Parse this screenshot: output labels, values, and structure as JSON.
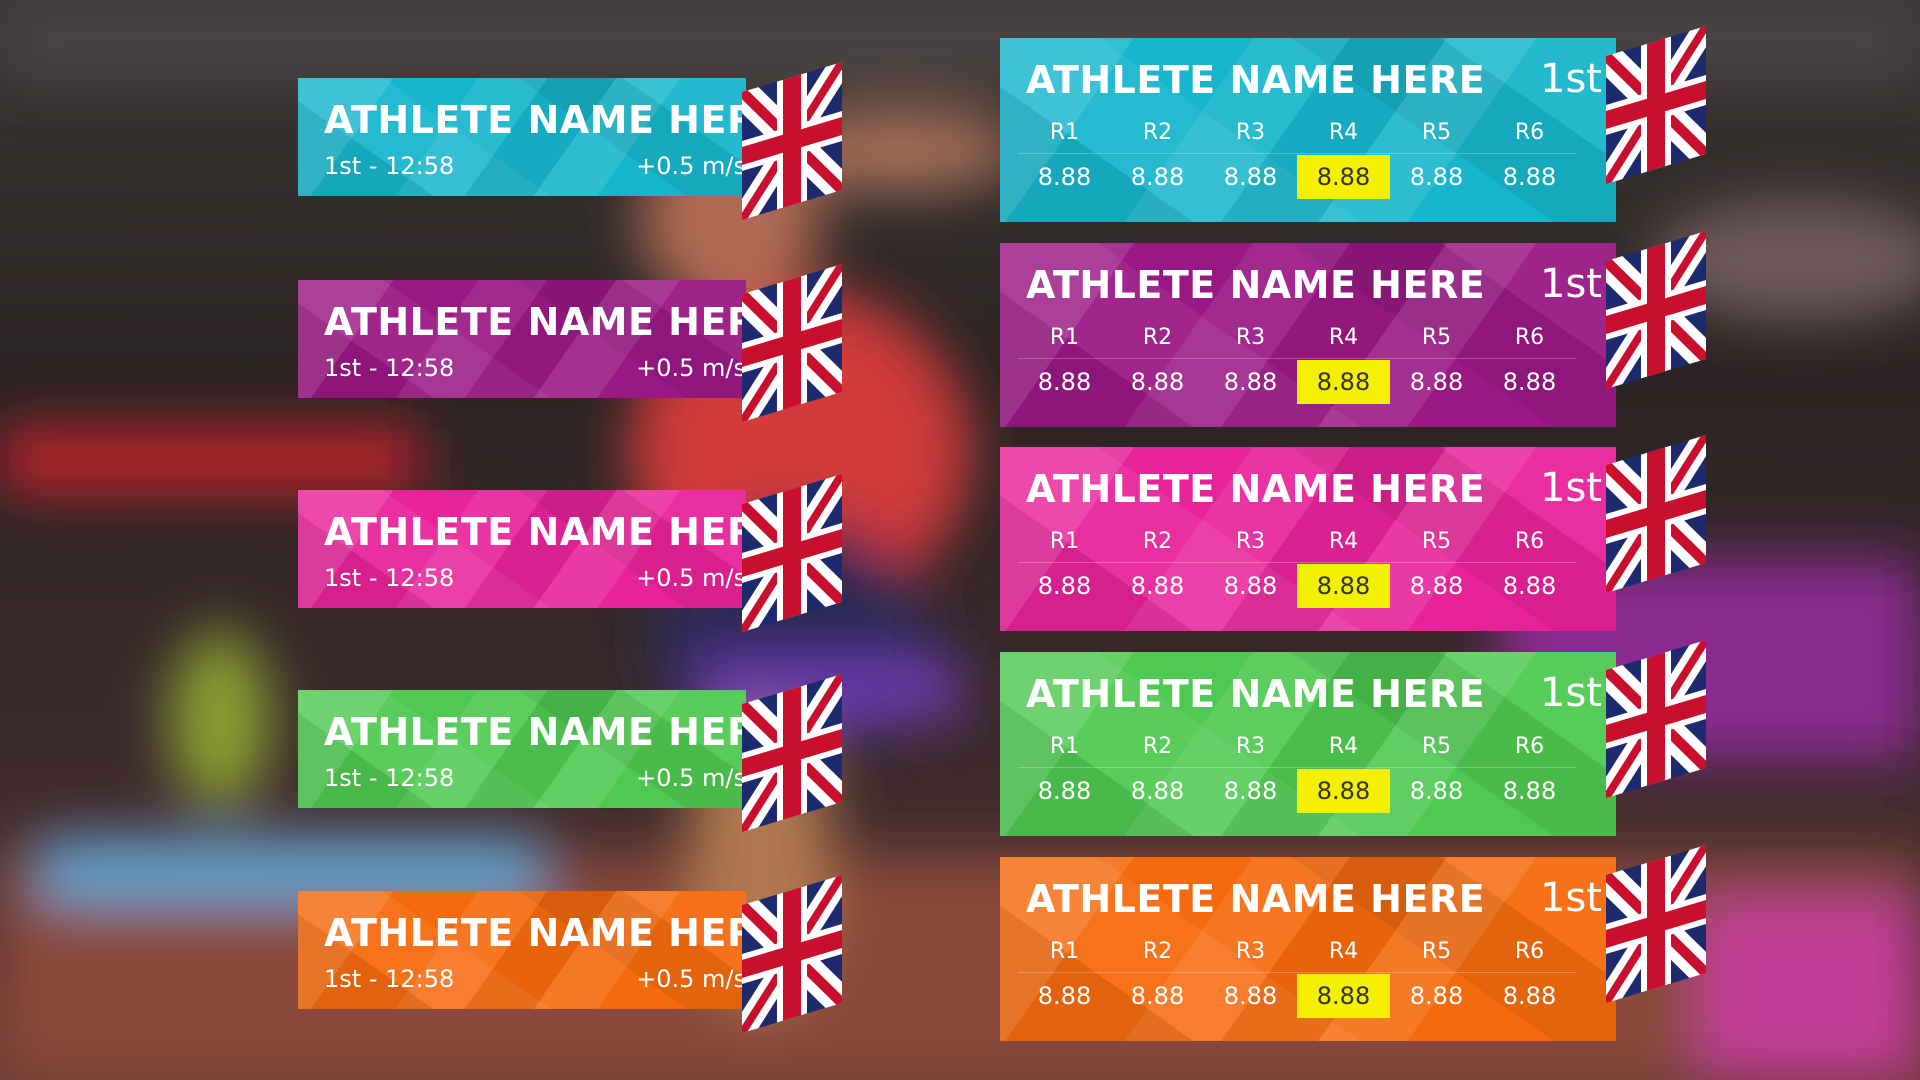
{
  "small_cards": [
    {
      "name": "ATHLETE NAME HERE",
      "position_time": "1st - 12:58",
      "wind": "+0.5 m/s",
      "color": "#17b6cc"
    },
    {
      "name": "ATHLETE NAME HERE",
      "position_time": "1st - 12:58",
      "wind": "+0.5 m/s",
      "color": "#9a1884"
    },
    {
      "name": "ATHLETE NAME HERE",
      "position_time": "1st - 12:58",
      "wind": "+0.5 m/s",
      "color": "#e8239a"
    },
    {
      "name": "ATHLETE NAME HERE",
      "position_time": "1st - 12:58",
      "wind": "+0.5 m/s",
      "color": "#4fc951"
    },
    {
      "name": "ATHLETE NAME HERE",
      "position_time": "1st - 12:58",
      "wind": "+0.5 m/s",
      "color": "#f56a0e"
    }
  ],
  "big_cards": [
    {
      "name": "ATHLETE NAME HERE",
      "rank": "1st",
      "color": "#17b6cc",
      "rounds": [
        {
          "label": "R1",
          "value": "8.88"
        },
        {
          "label": "R2",
          "value": "8.88"
        },
        {
          "label": "R3",
          "value": "8.88"
        },
        {
          "label": "R4",
          "value": "8.88"
        },
        {
          "label": "R5",
          "value": "8.88"
        },
        {
          "label": "R6",
          "value": "8.88"
        }
      ]
    },
    {
      "name": "ATHLETE NAME HERE",
      "rank": "1st",
      "color": "#9a1884",
      "rounds": [
        {
          "label": "R1",
          "value": "8.88"
        },
        {
          "label": "R2",
          "value": "8.88"
        },
        {
          "label": "R3",
          "value": "8.88"
        },
        {
          "label": "R4",
          "value": "8.88"
        },
        {
          "label": "R5",
          "value": "8.88"
        },
        {
          "label": "R6",
          "value": "8.88"
        }
      ]
    },
    {
      "name": "ATHLETE NAME HERE",
      "rank": "1st",
      "color": "#e8239a",
      "rounds": [
        {
          "label": "R1",
          "value": "8.88"
        },
        {
          "label": "R2",
          "value": "8.88"
        },
        {
          "label": "R3",
          "value": "8.88"
        },
        {
          "label": "R4",
          "value": "8.88"
        },
        {
          "label": "R5",
          "value": "8.88"
        },
        {
          "label": "R6",
          "value": "8.88"
        }
      ]
    },
    {
      "name": "ATHLETE NAME HERE",
      "rank": "1st",
      "color": "#4fc951",
      "rounds": [
        {
          "label": "R1",
          "value": "8.88"
        },
        {
          "label": "R2",
          "value": "8.88"
        },
        {
          "label": "R3",
          "value": "8.88"
        },
        {
          "label": "R4",
          "value": "8.88"
        },
        {
          "label": "R5",
          "value": "8.88"
        },
        {
          "label": "R6",
          "value": "8.88"
        }
      ]
    },
    {
      "name": "ATHLETE NAME HERE",
      "rank": "1st",
      "color": "#f56a0e",
      "rounds": [
        {
          "label": "R1",
          "value": "8.88"
        },
        {
          "label": "R2",
          "value": "8.88"
        },
        {
          "label": "R3",
          "value": "8.88"
        },
        {
          "label": "R4",
          "value": "8.88"
        },
        {
          "label": "R5",
          "value": "8.88"
        },
        {
          "label": "R6",
          "value": "8.88"
        }
      ]
    }
  ],
  "highlight_color": "#f4f000",
  "flag_icon": "union-jack-flag-icon"
}
